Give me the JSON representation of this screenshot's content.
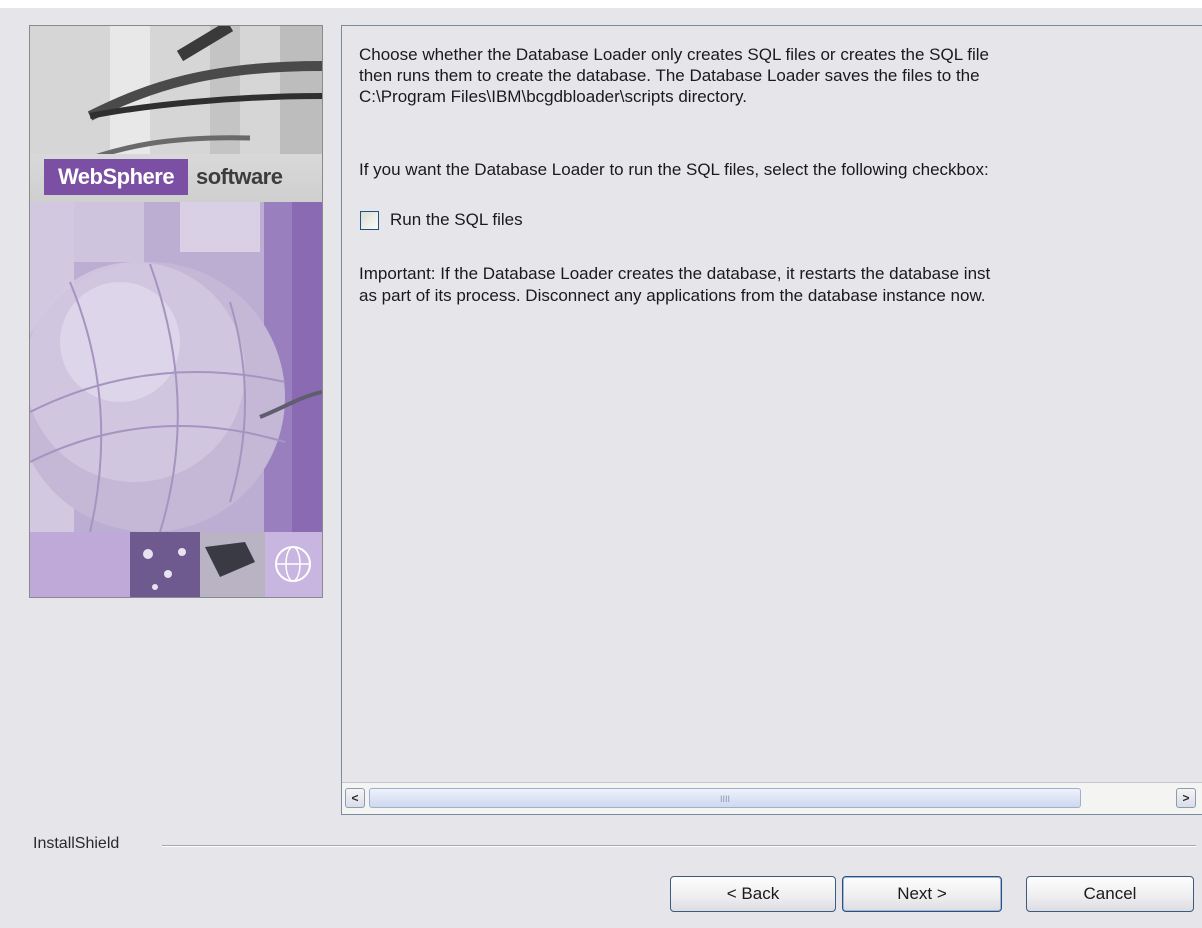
{
  "banner": {
    "brand": "WebSphere",
    "brand_suffix": "software"
  },
  "content": {
    "paragraph1_line1": "Choose whether the Database Loader only creates SQL files or creates the SQL file",
    "paragraph1_line2": "then runs them to create the database. The Database Loader saves the files to the",
    "paragraph1_line3": "C:\\Program Files\\IBM\\bcgdbloader\\scripts directory.",
    "paragraph2": "If you want the Database Loader to run the SQL files, select the following checkbox:",
    "checkbox_label": "Run the SQL files",
    "checkbox_checked": false,
    "important_line1": "Important: If the Database Loader creates the database, it restarts the database inst",
    "important_line2": "as part of its process. Disconnect any applications from the database instance now."
  },
  "scrollbar": {
    "left_icon": "chevron-left-icon",
    "right_icon": "chevron-right-icon",
    "left_glyph": "<",
    "right_glyph": ">",
    "grip": "IIII"
  },
  "footer": {
    "brand_label": "InstallShield",
    "back_label": "< Back",
    "next_label": "Next >",
    "cancel_label": "Cancel"
  },
  "colors": {
    "background": "#e6e6ea",
    "brand_purple": "#7b4fa3",
    "button_border": "#3d5a80"
  }
}
